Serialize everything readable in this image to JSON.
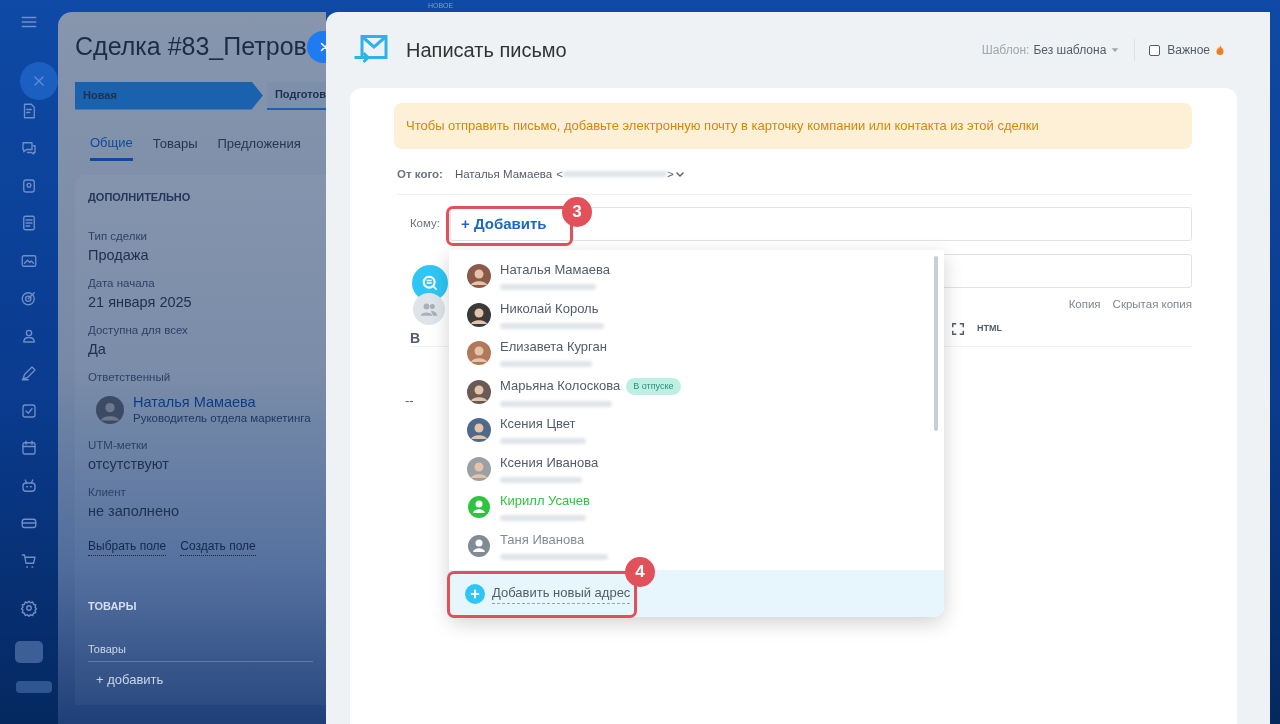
{
  "deal": {
    "title": "Сделка #83_Петров",
    "stages": [
      {
        "label": "Новая",
        "selected": true
      },
      {
        "label": "Подготов",
        "selected": false
      }
    ],
    "tabs": [
      {
        "label": "Общие",
        "selected": true
      },
      {
        "label": "Товары",
        "selected": false
      },
      {
        "label": "Предложения",
        "selected": false
      }
    ],
    "section_title": "ДОПОЛНИТЕЛЬНО",
    "fields": [
      {
        "kind": "text",
        "label": "Тип сделки",
        "value": "Продажа"
      },
      {
        "kind": "text",
        "label": "Дата начала",
        "value": "21 января 2025"
      },
      {
        "kind": "text",
        "label": "Доступна для всех",
        "value": "Да"
      },
      {
        "kind": "person",
        "label": "Ответственный",
        "value": "Наталья Мамаева",
        "subtitle": "Руководитель отдела маркетинга"
      },
      {
        "kind": "text",
        "label": "UTM-метки",
        "value": "отсутствуют"
      },
      {
        "kind": "text",
        "label": "Клиент",
        "value": "не заполнено"
      }
    ],
    "links": [
      "Выбрать поле",
      "Создать поле"
    ],
    "products": {
      "title": "ТОВАРЫ",
      "label": "Товары",
      "add": "+ добавить"
    }
  },
  "compose": {
    "tag": "НОВОЕ",
    "title": "Написать письмо",
    "template_label": "Шаблон:",
    "template_value": "Без шаблона",
    "important": {
      "label": "Важное",
      "checked": false
    },
    "warning": "Чтобы отправить письмо, добавьте электронную почту в карточку компании или контакта из этой сделки",
    "from_label": "От кого:",
    "from_name": "Наталья Мамаева",
    "from_open": "<",
    "from_close": ">",
    "to_label": "Кому:",
    "add_button": "+ Добавить",
    "copy_links": [
      "Копия",
      "Скрытая копия"
    ],
    "bold": "B",
    "html": "HTML",
    "signature": "--"
  },
  "contacts": [
    {
      "name": "Наталья Мамаева",
      "kind": "photo",
      "color": "#535c69"
    },
    {
      "name": "Николай Король",
      "kind": "photo",
      "color": "#535c69"
    },
    {
      "name": "Елизавета Курган",
      "kind": "photo",
      "color": "#535c69"
    },
    {
      "name": "Марьяна Колоскова",
      "kind": "photo",
      "color": "#535c69",
      "badge": "В отпуске"
    },
    {
      "name": "Ксения Цвет",
      "kind": "photo",
      "color": "#535c69"
    },
    {
      "name": "Ксения Иванова",
      "kind": "photo",
      "color": "#535c69"
    },
    {
      "name": "Кирилл Усачев",
      "kind": "default",
      "color": "#2fc43f"
    },
    {
      "name": "Таня Иванова",
      "kind": "default",
      "color": "#828b95"
    }
  ],
  "add_new": "Добавить новый адрес",
  "callouts": [
    {
      "number": "3"
    },
    {
      "number": "4"
    }
  ]
}
